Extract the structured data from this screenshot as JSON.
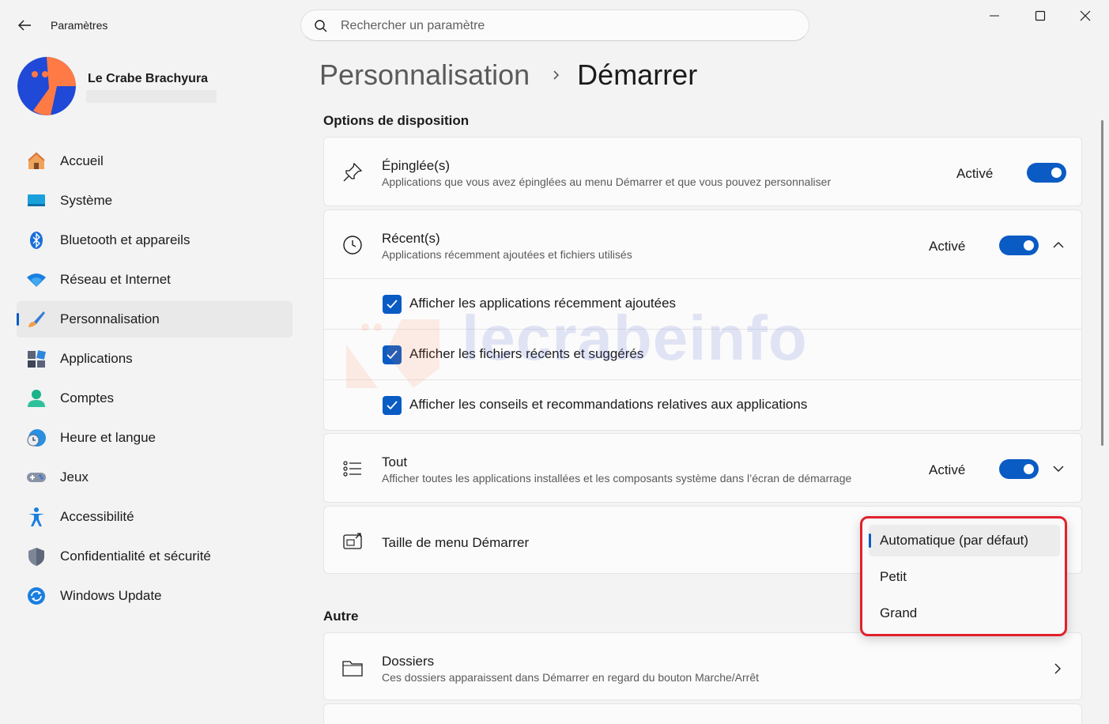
{
  "window": {
    "app_title": "Paramètres",
    "controls": [
      "minimize-icon",
      "maximize-icon",
      "close-icon"
    ]
  },
  "search": {
    "placeholder": "Rechercher un paramètre"
  },
  "profile": {
    "name": "Le Crabe Brachyura"
  },
  "sidebar": {
    "items": [
      {
        "label": "Accueil",
        "icon": "home-icon"
      },
      {
        "label": "Système",
        "icon": "system-icon"
      },
      {
        "label": "Bluetooth et appareils",
        "icon": "bluetooth-icon"
      },
      {
        "label": "Réseau et Internet",
        "icon": "wifi-icon"
      },
      {
        "label": "Personnalisation",
        "icon": "brush-icon",
        "active": true
      },
      {
        "label": "Applications",
        "icon": "apps-icon"
      },
      {
        "label": "Comptes",
        "icon": "account-icon"
      },
      {
        "label": "Heure et langue",
        "icon": "time-language-icon"
      },
      {
        "label": "Jeux",
        "icon": "gamepad-icon"
      },
      {
        "label": "Accessibilité",
        "icon": "accessibility-icon"
      },
      {
        "label": "Confidentialité et sécurité",
        "icon": "shield-icon"
      },
      {
        "label": "Windows Update",
        "icon": "update-icon"
      }
    ]
  },
  "breadcrumb": {
    "parent": "Personnalisation",
    "current": "Démarrer"
  },
  "layout_options": {
    "heading": "Options de disposition",
    "pinned": {
      "title": "Épinglée(s)",
      "subtitle": "Applications que vous avez épinglées au menu Démarrer et que vous pouvez personnaliser",
      "state": "Activé",
      "on": true
    },
    "recent": {
      "title": "Récent(s)",
      "subtitle": "Applications récemment ajoutées et fichiers utilisés",
      "state": "Activé",
      "on": true,
      "expanded": true,
      "options": [
        {
          "label": "Afficher les applications récemment ajoutées",
          "checked": true
        },
        {
          "label": "Afficher les fichiers récents et suggérés",
          "checked": true
        },
        {
          "label": "Afficher les conseils et recommandations relatives aux applications",
          "checked": true
        }
      ]
    },
    "all": {
      "title": "Tout",
      "subtitle": "Afficher toutes les applications installées et les composants système dans l’écran de démarrage",
      "state": "Activé",
      "on": true,
      "expanded": false
    },
    "menu_size": {
      "title": "Taille de menu Démarrer",
      "options": [
        "Automatique (par défaut)",
        "Petit",
        "Grand"
      ],
      "selected": "Automatique (par défaut)"
    }
  },
  "other": {
    "heading": "Autre",
    "folders": {
      "title": "Dossiers",
      "subtitle": "Ces dossiers apparaissent dans Démarrer en regard du bouton Marche/Arrêt"
    }
  },
  "watermark": {
    "text": "lecrabeinfo"
  },
  "colors": {
    "accent": "#0a5bc4",
    "highlight_border": "#e0212d",
    "background": "#f3f3f3",
    "card": "#fbfbfb"
  }
}
